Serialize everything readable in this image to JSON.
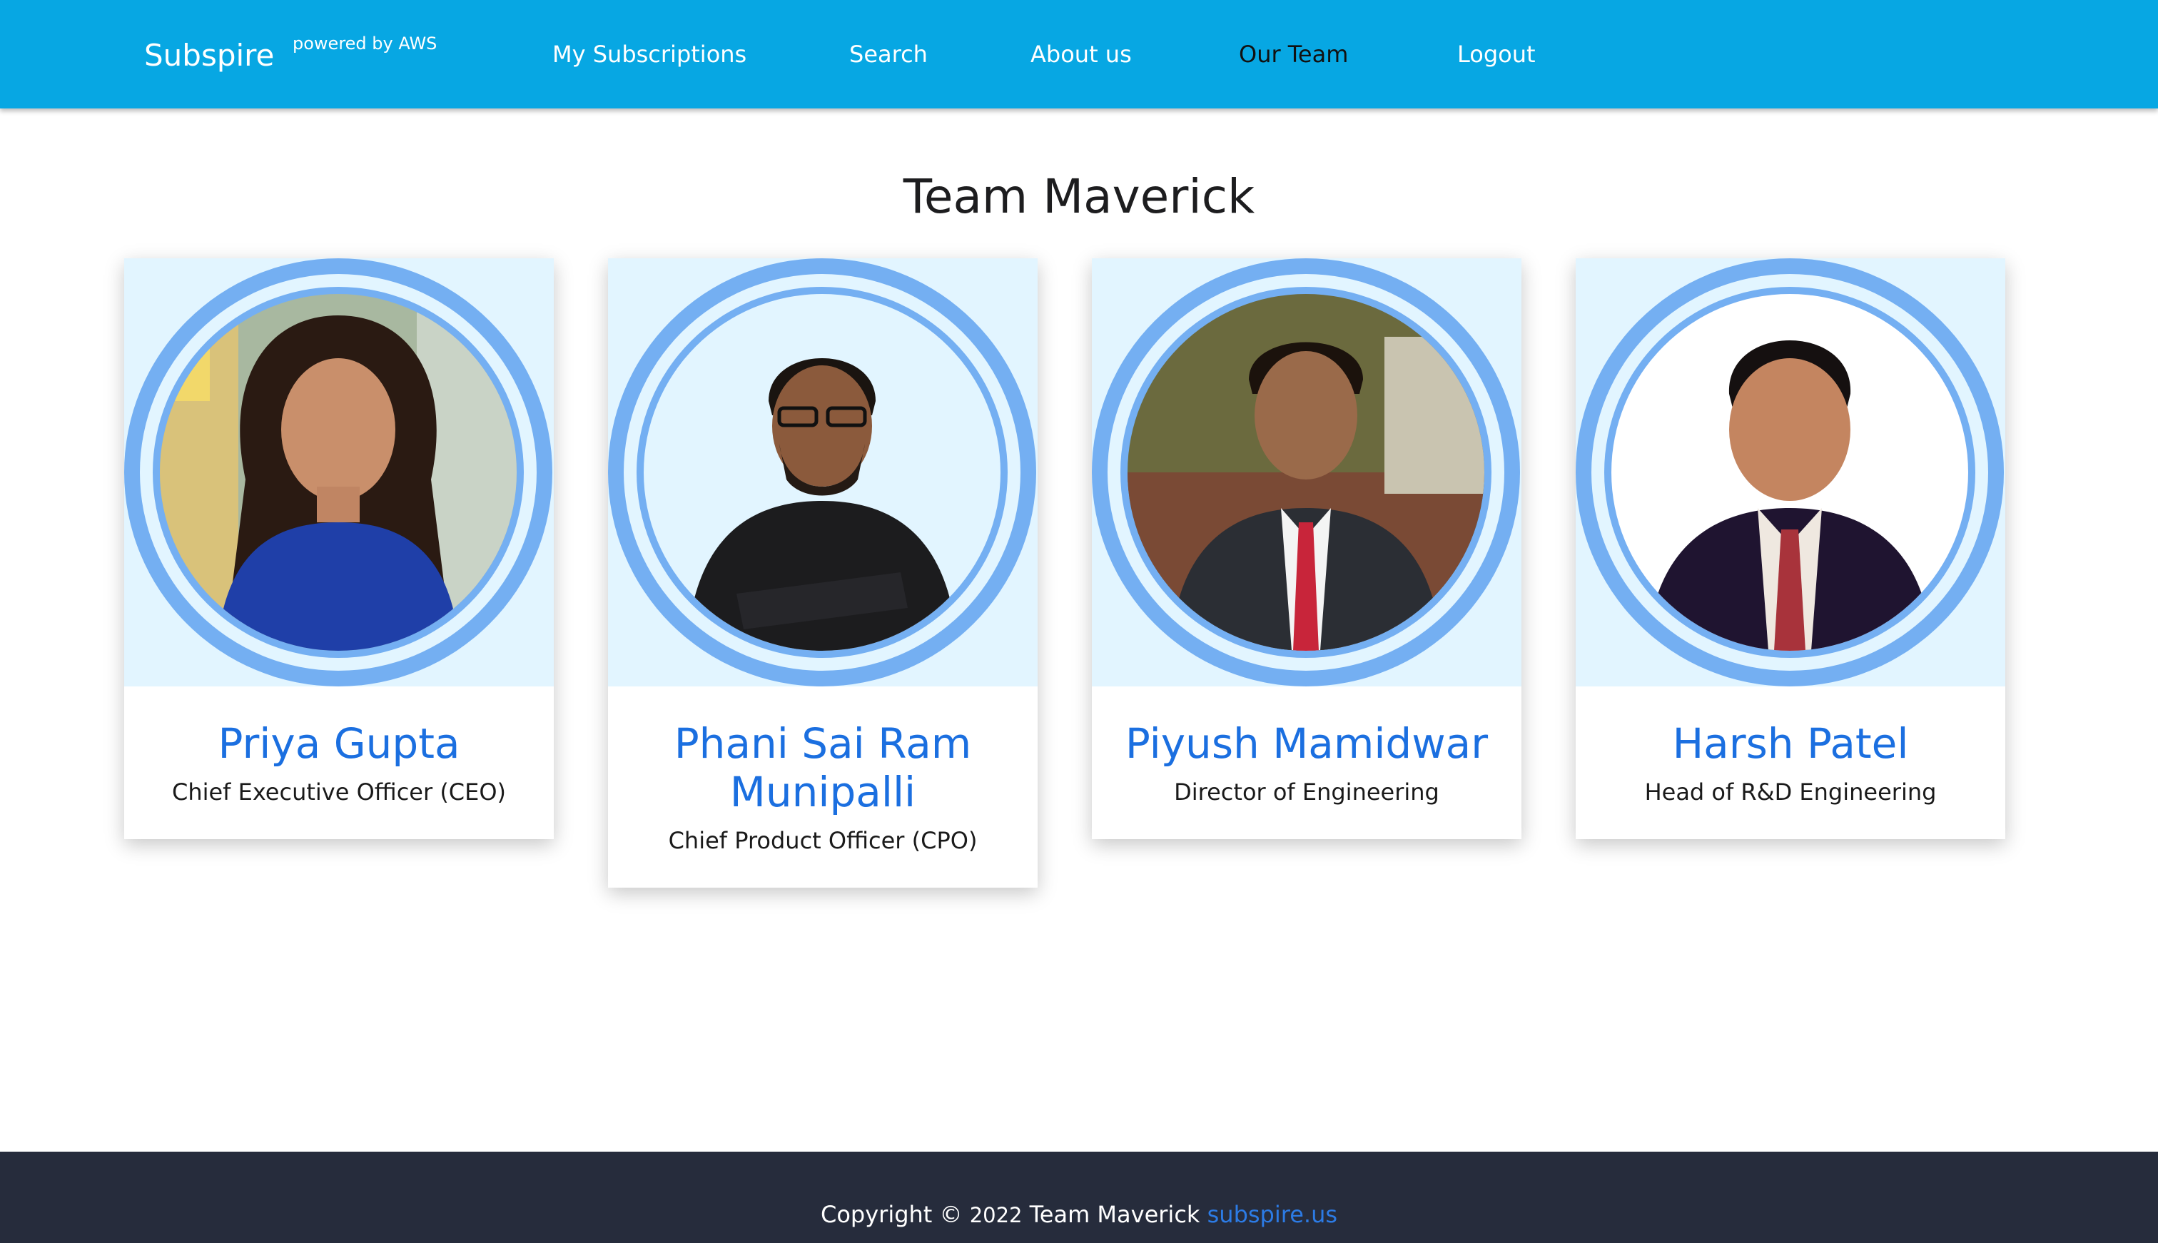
{
  "navbar": {
    "brand": "Subspire",
    "powered_by": "powered by AWS",
    "links": [
      "My Subscriptions",
      "Search",
      "About us",
      "Our Team",
      "Logout"
    ],
    "active": "Our Team"
  },
  "page": {
    "title": "Team Maverick"
  },
  "team": [
    {
      "name": "Priya Gupta",
      "role": "Chief Executive Officer (CEO)"
    },
    {
      "name": "Phani Sai Ram Munipalli",
      "role": "Chief Product Officer (CPO)"
    },
    {
      "name": "Piyush Mamidwar",
      "role": "Director of Engineering"
    },
    {
      "name": "Harsh Patel",
      "role": "Head of R&D Engineering"
    }
  ],
  "footer": {
    "prefix": "Copyright ©",
    "year": "2022",
    "team": "Team Maverick",
    "link_text": "subspire.us"
  },
  "colors": {
    "navbar": "#07a7e3",
    "avatar_bg": "#e2f5ff",
    "ring": "#74aff2",
    "name": "#1b6fe0",
    "footer_bg": "#262c3c",
    "footer_link": "#2c7be5"
  },
  "icons": [
    "profile-photo"
  ]
}
